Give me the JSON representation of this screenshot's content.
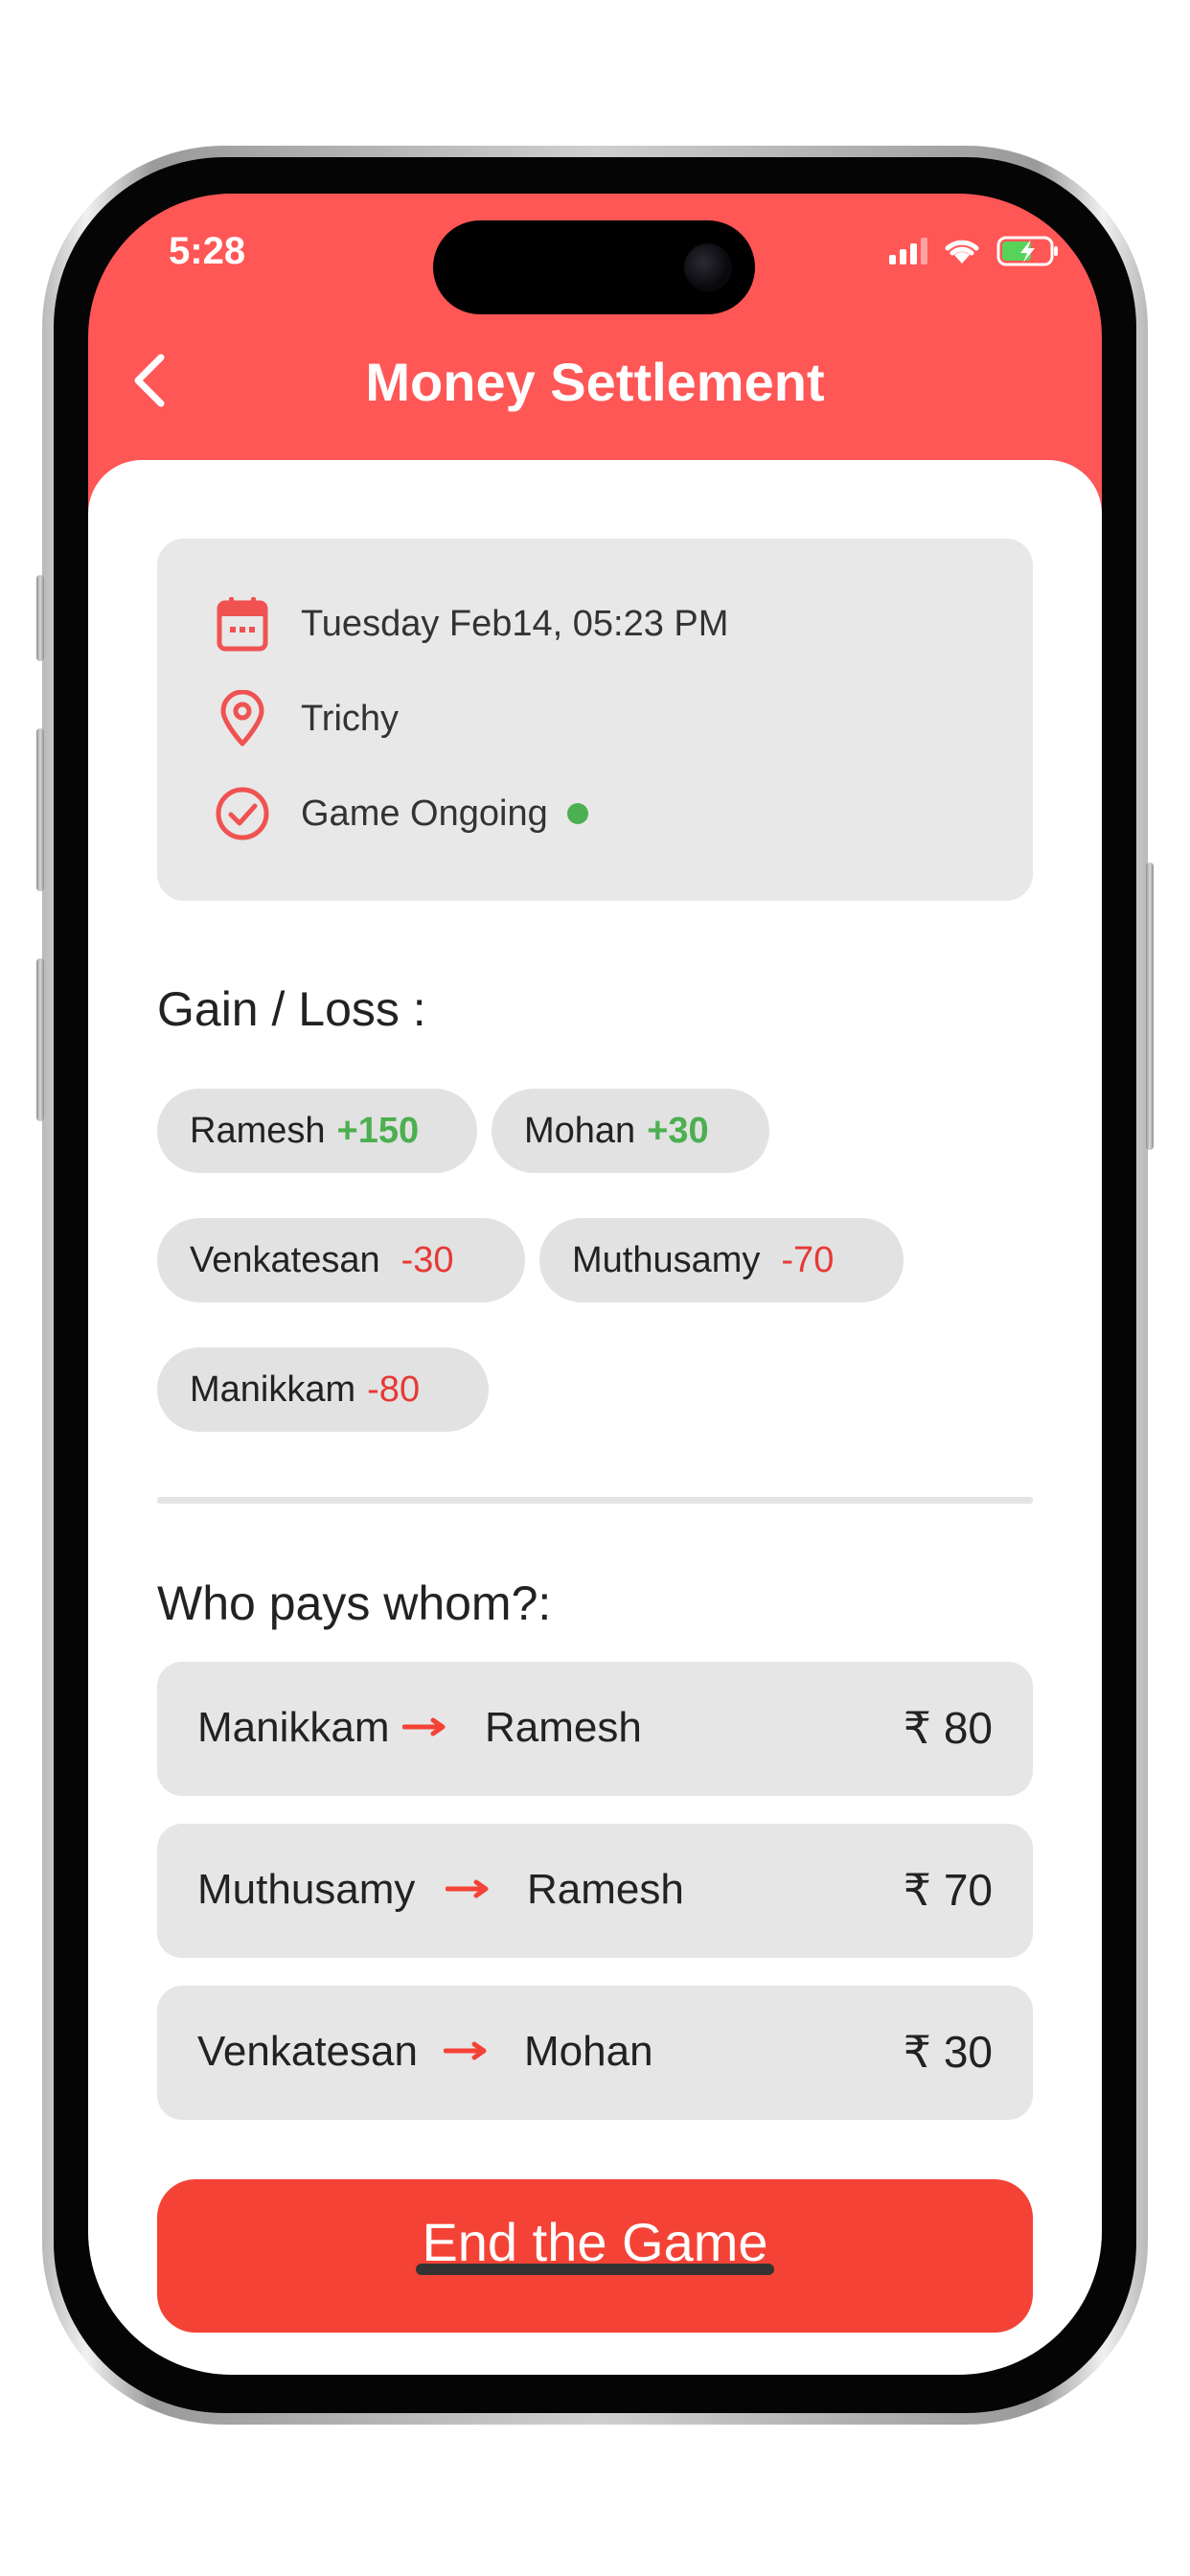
{
  "status_bar": {
    "time": "5:28"
  },
  "header": {
    "title": "Money Settlement",
    "back_icon": "chevron-left-icon"
  },
  "game_info": {
    "datetime": "Tuesday Feb14, 05:23 PM",
    "location": "Trichy",
    "status": "Game Ongoing",
    "status_color": "#4caf50"
  },
  "gain_loss": {
    "title": "Gain / Loss :",
    "players": [
      {
        "name": "Ramesh",
        "amount": "+150"
      },
      {
        "name": "Mohan",
        "amount": "+30"
      },
      {
        "name": "Venkatesan",
        "amount": "-30"
      },
      {
        "name": "Muthusamy",
        "amount": "-70"
      },
      {
        "name": "Manikkam",
        "amount": "-80"
      }
    ]
  },
  "payments": {
    "title": "Who pays whom?:",
    "items": [
      {
        "from": "Manikkam",
        "to": "Ramesh",
        "amount": "₹ 80"
      },
      {
        "from": "Muthusamy",
        "to": "Ramesh",
        "amount": "₹ 70"
      },
      {
        "from": "Venkatesan",
        "to": "Mohan",
        "amount": "₹ 30"
      }
    ]
  },
  "end_button": {
    "label": "End the Game"
  },
  "colors": {
    "accent": "#ff5656",
    "positive": "#4caf50",
    "negative": "#e53935",
    "arrow": "#f44336",
    "button": "#f44336"
  }
}
